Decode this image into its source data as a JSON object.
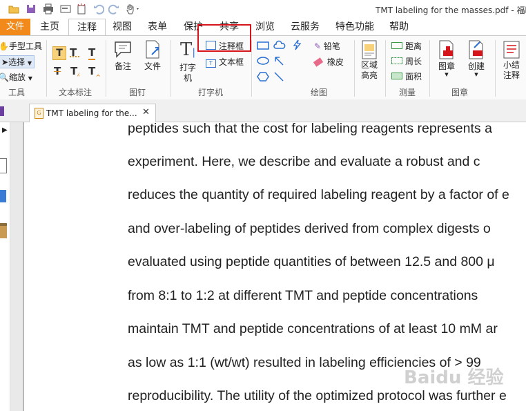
{
  "window": {
    "doc_title": "TMT labeling for the masses.pdf - 福昕阅"
  },
  "menu": {
    "file": "文件",
    "tabs": [
      "主页",
      "注释",
      "视图",
      "表单",
      "保护",
      "共享",
      "浏览",
      "云服务",
      "特色功能",
      "帮助"
    ]
  },
  "ribbon": {
    "tools": {
      "hand": "手型工具",
      "select": "选择",
      "zoom": "缩放",
      "group": "工具"
    },
    "text_markup": {
      "group": "文本标注"
    },
    "pin": {
      "note": "备注",
      "file": "文件",
      "group": "图钉"
    },
    "typewriter": {
      "typewriter": "打字机",
      "callout": "注释框",
      "textbox": "文本框",
      "group": "打字机"
    },
    "drawing": {
      "pencil": "铅笔",
      "eraser": "橡皮",
      "group": "绘图"
    },
    "area": {
      "highlight": "区域高亮"
    },
    "measure": {
      "distance": "距离",
      "perimeter": "周长",
      "area": "面积",
      "group": "测量"
    },
    "stamp": {
      "stamp": "图章",
      "create": "创建",
      "group": "图章"
    },
    "summary": {
      "label": "小结注释"
    }
  },
  "doc_tab": {
    "label": "TMT labeling for the..."
  },
  "document": {
    "lines": [
      "peptides such that the cost for labeling reagents represents a",
      "experiment. Here, we describe and evaluate a robust and c",
      "reduces the quantity of required labeling reagent by a factor of e",
      "and over-labeling of peptides derived from complex digests o",
      "evaluated using peptide quantities of between 12.5 and 800 μ",
      "from 8:1 to 1:2 at different TMT and peptide concentrations",
      "maintain TMT and peptide concentrations of at least 10 mM ar",
      "as low as 1:1 (wt/wt) resulted in labeling efficiencies of > 99",
      "reproducibility. The utility of the optimized protocol was further e"
    ]
  },
  "watermark": "Baidu 经验",
  "colors": {
    "file_tab": "#f28a1b",
    "highlight_box": "#d4161c"
  }
}
